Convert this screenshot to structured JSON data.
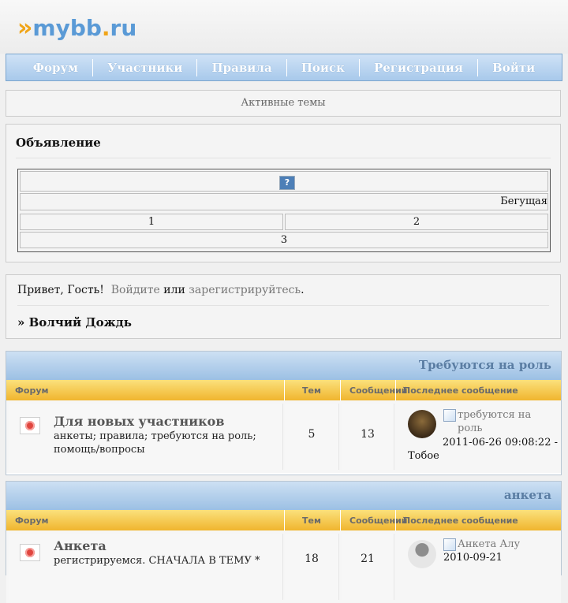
{
  "logo": {
    "chevrons": "»",
    "name": "mybb",
    "dot": ".",
    "tld": "ru"
  },
  "nav": {
    "items": [
      "Форум",
      "Участники",
      "Правила",
      "Поиск",
      "Регистрация",
      "Войти"
    ]
  },
  "active_topics": "Активные темы",
  "announcement": {
    "title": "Объявление",
    "help_icon": "?",
    "marquee": "Бегущая",
    "cell1": "1",
    "cell2": "2",
    "cell3": "3"
  },
  "welcome": {
    "greeting": "Привет, Гость!",
    "login": "Войдите",
    "or": "или",
    "register": "зарегистрируйтесь",
    "period": ".",
    "board": "» Волчий Дождь"
  },
  "columns": {
    "forum": "Форум",
    "topics": "Тем",
    "posts": "Сообщений",
    "last": "Последнее сообщение"
  },
  "categories": [
    {
      "name": "Требуются на роль",
      "forum": {
        "name": "Для новых участников",
        "desc": "анкеты; правила; требуются на роль; помощь/вопросы",
        "topics": "5",
        "posts": "13",
        "last_title": "требуются на роль",
        "last_date": "2011-06-26 09:08:22 - Тобое"
      }
    },
    {
      "name": "анкета",
      "forum": {
        "name": "Анкета",
        "desc": "регистрируемся. СНАЧАЛА В ТЕМУ *",
        "topics": "18",
        "posts": "21",
        "last_title": "Анкета Алу",
        "last_date": "2010-09-21"
      }
    }
  ],
  "icons": {
    "forum": "forum-unread-icon",
    "last_post": "post-icon",
    "help": "help-icon"
  }
}
